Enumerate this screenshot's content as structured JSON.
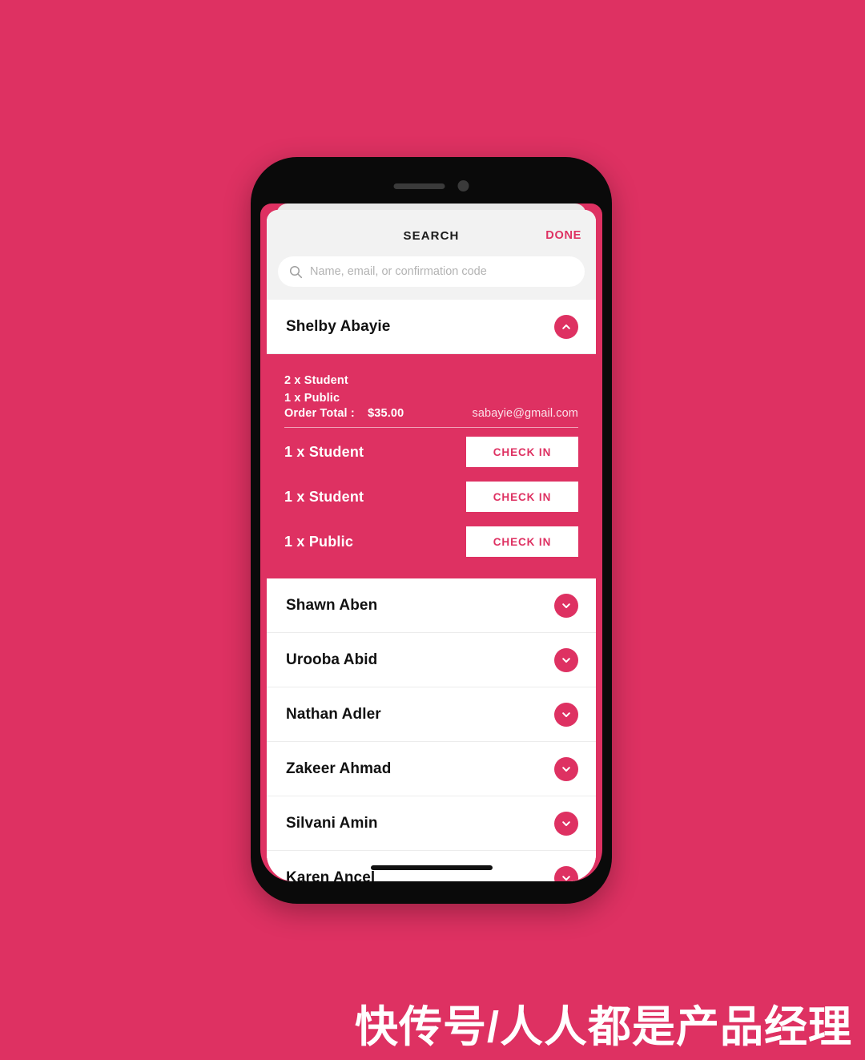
{
  "colors": {
    "brand_pink": "#DE3162",
    "sheet_white": "#FFFFFF",
    "header_gray": "#F2F2F2",
    "text_dark": "#111111"
  },
  "header": {
    "title": "SEARCH",
    "done_label": "DONE"
  },
  "search": {
    "value": "",
    "placeholder": "Name, email, or confirmation code",
    "icon": "search-icon"
  },
  "expanded_attendee": {
    "name": "Shelby Abayie",
    "toggle_icon": "chevron-up-icon",
    "order": {
      "lines": [
        "2 x Student",
        "1 x Public"
      ],
      "total_label": "Order Total :",
      "total_amount": "$35.00",
      "email": "sabayie@gmail.com"
    },
    "tickets": [
      {
        "label": "1 x Student",
        "action": "CHECK IN"
      },
      {
        "label": "1 x Student",
        "action": "CHECK IN"
      },
      {
        "label": "1 x Public",
        "action": "CHECK IN"
      }
    ]
  },
  "attendees": [
    {
      "name": "Shawn Aben",
      "toggle_icon": "chevron-down-icon"
    },
    {
      "name": "Urooba Abid",
      "toggle_icon": "chevron-down-icon"
    },
    {
      "name": "Nathan Adler",
      "toggle_icon": "chevron-down-icon"
    },
    {
      "name": "Zakeer Ahmad",
      "toggle_icon": "chevron-down-icon"
    },
    {
      "name": "Silvani Amin",
      "toggle_icon": "chevron-down-icon"
    },
    {
      "name": "Karen Ancel",
      "toggle_icon": "chevron-down-icon"
    }
  ],
  "watermark": {
    "text": "快传号/人人都是产品经理"
  }
}
